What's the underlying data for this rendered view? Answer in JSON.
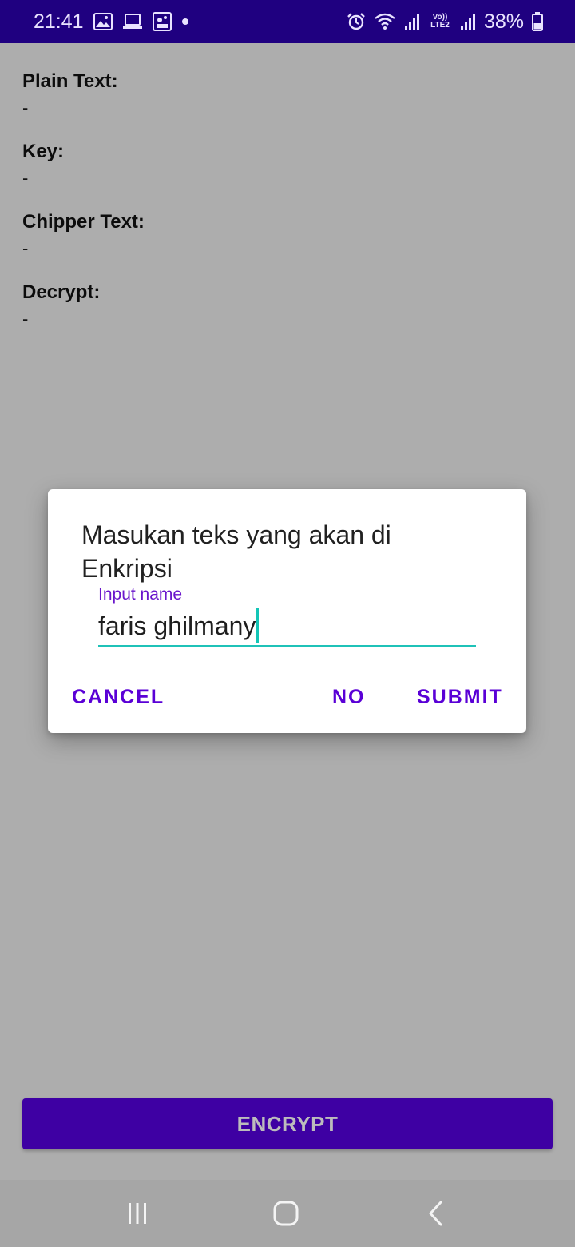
{
  "status_bar": {
    "time": "21:41",
    "left_icons": [
      "gallery-icon",
      "laptop-icon",
      "game-icon",
      "dot-icon"
    ],
    "right_icons": [
      "alarm-icon",
      "wifi-icon",
      "signal-icon",
      "volte-icon",
      "signal-icon"
    ],
    "volte_label": "Vo)) LTE2",
    "battery": "38%"
  },
  "fields": [
    {
      "label": "Plain Text:",
      "value": "-"
    },
    {
      "label": "Key:",
      "value": "-"
    },
    {
      "label": "Chipper Text:",
      "value": "-"
    },
    {
      "label": "Decrypt:",
      "value": "-"
    }
  ],
  "dialog": {
    "title": "Masukan teks yang akan di Enkripsi",
    "input_label": "Input name",
    "input_value": "faris ghilmany",
    "cancel_label": "CANCEL",
    "no_label": "NO",
    "submit_label": "SUBMIT"
  },
  "encrypt_button": {
    "label": "ENCRYPT"
  },
  "nav": {
    "icons": [
      "recents-icon",
      "home-icon",
      "back-icon"
    ]
  },
  "colors": {
    "status_bar": "#1f0080",
    "accent": "#5a00d6",
    "input_underline": "#1fc2b8",
    "encrypt_button": "#3e00a3",
    "scrim": "#adadad"
  }
}
